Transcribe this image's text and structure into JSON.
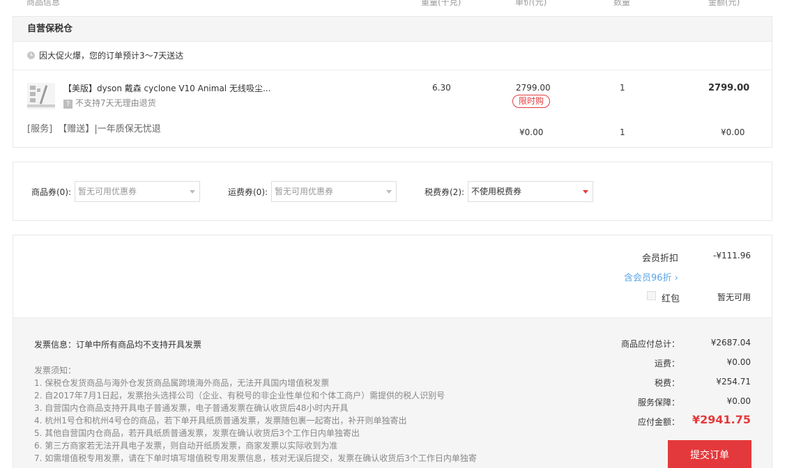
{
  "columns": {
    "info": "商品信息",
    "weight": "重量(千克)",
    "unit_price": "单价(元)",
    "qty": "数量",
    "amount": "金额(元)"
  },
  "warehouse": {
    "title": "自营保税仓",
    "notice": "因大促火爆，您的订单预计3～7天送达"
  },
  "product": {
    "title": "【美版】dyson 戴森 cyclone V10 Animal 无线吸尘...",
    "return_policy": "不支持7天无理由退货",
    "return_icon": "?",
    "weight": "6.30",
    "unit_price": "2799.00",
    "tag": "限时购",
    "qty": "1",
    "amount": "2799.00"
  },
  "service": {
    "label": "[服务]",
    "gift": "【赠送】",
    "text": "|一年质保无忧退",
    "unit_price": "¥0.00",
    "qty": "1",
    "amount": "¥0.00"
  },
  "coupons": {
    "goods_label": "商品券(0):",
    "goods_value": "暂无可用优惠券",
    "freight_label": "运费券(0):",
    "freight_value": "暂无可用优惠券",
    "tax_label": "税费券(2):",
    "tax_value": "不使用税费券"
  },
  "discounts": {
    "member_label": "会员折扣",
    "member_value": "-¥111.96",
    "member_link": "含会员96折 ›",
    "redpacket_label": "红包",
    "redpacket_value": "暂无可用"
  },
  "invoice": {
    "title": "发票信息：订单中所有商品均不支持开具发票",
    "notes_title": "发票须知：",
    "notes": [
      "1. 保税仓发货商品与海外仓发货商品属跨境海外商品，无法开具国内增值税发票",
      "2. 自2017年7月1日起，发票抬头选择公司（企业、有税号的非企业性单位和个体工商户）需提供的税人识别号",
      "3. 自营国内仓商品支持开具电子普通发票，电子普通发票在确认收货后48小时内开具",
      "4. 杭州1号仓和杭州4号仓的商品，若下单开具纸质普通发票，发票随包裹一起寄出，补开则单独寄出",
      "5. 其他自营国内仓商品，若开具纸质普通发票，发票在确认收货后3个工作日内单独寄出",
      "6. 第三方商家若无法开具电子发票，则自动开纸质发票，商家发票以实际收到为准",
      "7. 如需增值税专用发票，请在下单时填写增值税专用发票信息，核对无误后提交，发票在确认收货后3个工作日内单独寄"
    ]
  },
  "summary": {
    "goods_total_label": "商品应付总计：",
    "goods_total": "¥2687.04",
    "freight_label": "运费：",
    "freight": "¥0.00",
    "tax_label": "税费：",
    "tax": "¥254.71",
    "service_label": "服务保障：",
    "service": "¥0.00",
    "payable_label": "应付金额：",
    "payable": "¥2941.75",
    "submit": "提交订单"
  },
  "colors": {
    "accent": "#e4393c",
    "link": "#5aa5e8"
  }
}
